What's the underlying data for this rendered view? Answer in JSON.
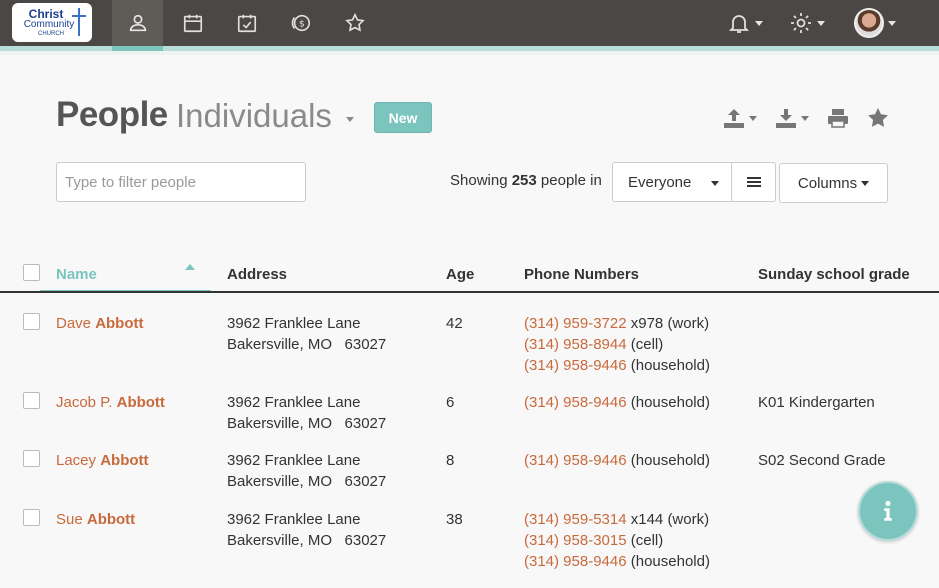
{
  "logo": {
    "line1": "Christ",
    "line2": "Community",
    "line3": "CHURCH"
  },
  "nav": {
    "tabs": [
      {
        "icon": "people-icon",
        "active": true
      },
      {
        "icon": "calendar-icon",
        "active": false
      },
      {
        "icon": "checklist-icon",
        "active": false
      },
      {
        "icon": "giving-icon",
        "active": false
      },
      {
        "icon": "star-icon",
        "active": false
      }
    ],
    "right": [
      "bell-icon",
      "gear-icon",
      "avatar"
    ]
  },
  "header": {
    "title": "People",
    "subtitle": "Individuals",
    "new_label": "New",
    "tools": [
      "upload-icon",
      "download-icon",
      "print-icon",
      "star-icon"
    ]
  },
  "filter": {
    "placeholder": "Type to filter people",
    "showing_prefix": "Showing ",
    "count": "253",
    "showing_suffix": " people in",
    "group": "Everyone",
    "columns_label": "Columns"
  },
  "table": {
    "columns": [
      "Name",
      "Address",
      "Age",
      "Phone Numbers",
      "Sunday school grade"
    ],
    "rows": [
      {
        "first": "Dave ",
        "last": "Abbott",
        "address1": "3962 Franklee Lane",
        "address2": "Bakersville, MO   63027",
        "age": "42",
        "phones": [
          {
            "number": "(314) 959-3722",
            "suffix": " x978 (work)"
          },
          {
            "number": "(314) 958-8944",
            "suffix": " (cell)"
          },
          {
            "number": "(314) 958-9446",
            "suffix": " (household)"
          }
        ],
        "grade": ""
      },
      {
        "first": "Jacob P. ",
        "last": "Abbott",
        "address1": "3962 Franklee Lane",
        "address2": "Bakersville, MO   63027",
        "age": "6",
        "phones": [
          {
            "number": "(314) 958-9446",
            "suffix": " (household)"
          }
        ],
        "grade": "K01 Kindergarten"
      },
      {
        "first": "Lacey ",
        "last": "Abbott",
        "address1": "3962 Franklee Lane",
        "address2": "Bakersville, MO   63027",
        "age": "8",
        "phones": [
          {
            "number": "(314) 958-9446",
            "suffix": " (household)"
          }
        ],
        "grade": "S02 Second Grade"
      },
      {
        "first": "Sue ",
        "last": "Abbott",
        "address1": "3962 Franklee Lane",
        "address2": "Bakersville, MO   63027",
        "age": "38",
        "phones": [
          {
            "number": "(314) 959-5314",
            "suffix": " x144 (work)"
          },
          {
            "number": "(314) 958-3015",
            "suffix": " (cell)"
          },
          {
            "number": "(314) 958-9446",
            "suffix": " (household)"
          }
        ],
        "grade": ""
      }
    ]
  },
  "colors": {
    "accent": "#7cc4be",
    "link": "#c86a3c",
    "navbar": "#4a4744"
  }
}
